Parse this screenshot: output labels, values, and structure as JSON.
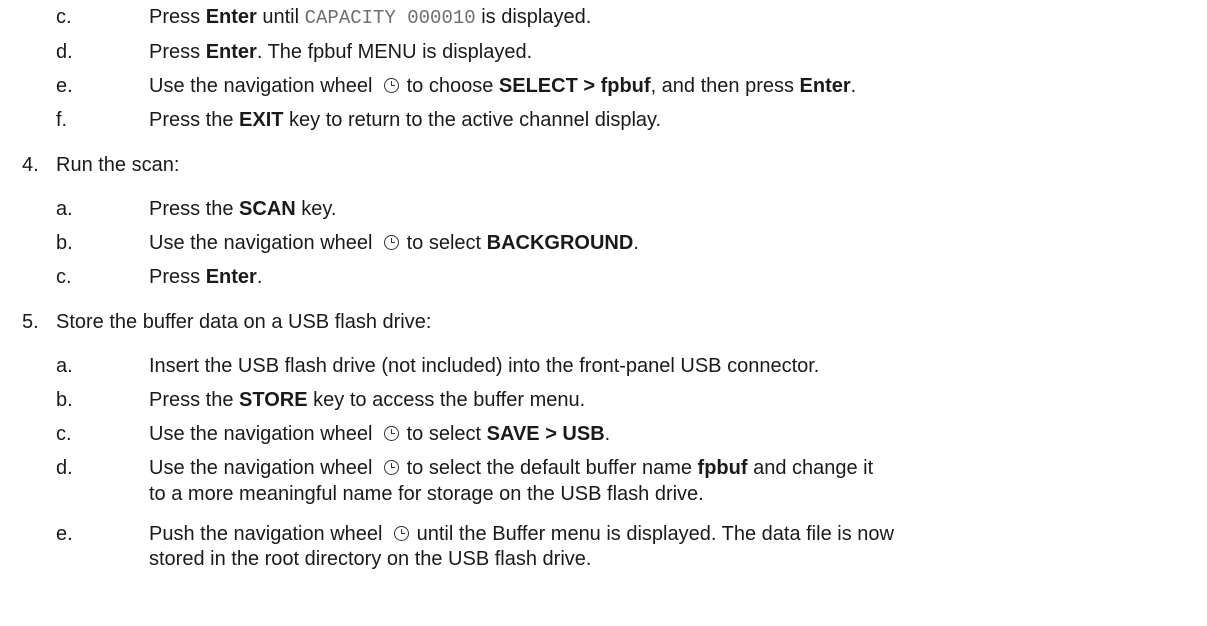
{
  "step3_cont": {
    "c": {
      "letter": "c.",
      "p1": "Press ",
      "b1": "Enter",
      "p2": " until ",
      "code": "CAPACITY 000010",
      "p3": " is displayed."
    },
    "d": {
      "letter": "d.",
      "p1": "Press ",
      "b1": "Enter",
      "p2": ". The fpbuf MENU is displayed."
    },
    "e": {
      "letter": "e.",
      "p1": "Use the navigation wheel ",
      "p2": " to choose ",
      "b1": "SELECT > fpbuf",
      "p3": ", and then press ",
      "b2": "Enter",
      "p4": "."
    },
    "f": {
      "letter": "f.",
      "p1": "Press the ",
      "b1": "EXIT",
      "p2": " key to return to the active channel display."
    }
  },
  "step4": {
    "num": "4.",
    "title": "Run the scan:",
    "a": {
      "letter": "a.",
      "p1": "Press the ",
      "b1": "SCAN",
      "p2": " key."
    },
    "b": {
      "letter": "b.",
      "p1": "Use the navigation wheel ",
      "p2": " to select ",
      "b1": "BACKGROUND",
      "p3": "."
    },
    "c": {
      "letter": "c.",
      "p1": "Press ",
      "b1": "Enter",
      "p2": "."
    }
  },
  "step5": {
    "num": "5.",
    "title": "Store the buffer data on a USB flash drive:",
    "a": {
      "letter": "a.",
      "text": "Insert the USB flash drive (not included) into the front-panel USB connector."
    },
    "b": {
      "letter": "b.",
      "p1": "Press the ",
      "b1": "STORE",
      "p2": " key to access the buffer menu."
    },
    "c": {
      "letter": "c.",
      "p1": "Use the navigation wheel ",
      "p2": " to select ",
      "b1": "SAVE > USB",
      "p3": "."
    },
    "d": {
      "letter": "d.",
      "p1": "Use the navigation wheel ",
      "p2": " to select the default buffer name ",
      "b1": "fpbuf",
      "p3": " and change it",
      "line2": "to a more meaningful name for storage on the USB flash drive."
    },
    "e": {
      "letter": "e.",
      "p1": "Push the navigation wheel ",
      "p2": " until the Buffer menu is displayed. The data file is now",
      "line2": "stored in the root directory on the USB flash drive."
    }
  },
  "icons": {
    "wheel": "navigation-wheel-icon"
  }
}
